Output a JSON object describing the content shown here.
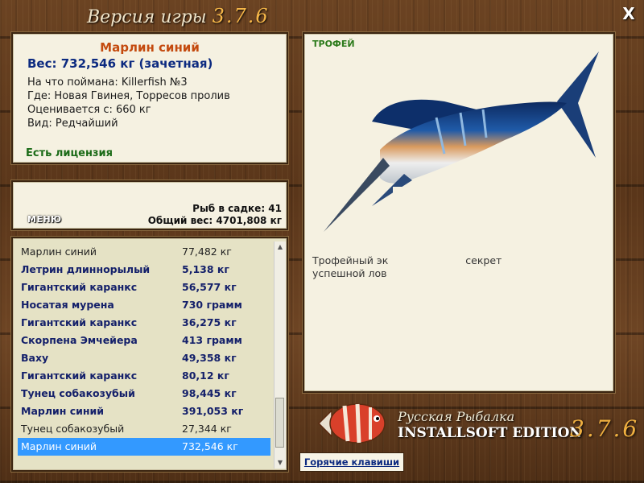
{
  "window": {
    "title": "Версия игры",
    "version": "3.7.6",
    "close_label": "X"
  },
  "info": {
    "fish_name": "Марлин синий",
    "weight": "Вес: 732,546 кг (зачетная)",
    "bait": "На что поймана: Killerfish №3",
    "location": "Где: Новая Гвинея, Торресов пролив",
    "valued_from": "Оценивается с: 660 кг",
    "rarity": "Вид: Редчайший",
    "license": "Есть лицензия"
  },
  "stats": {
    "menu_label": "МЕНЮ",
    "fish_in_cage": "Рыб в садке: 41",
    "total_weight": "Общий вес: 4701,808 кг"
  },
  "catch_list": [
    {
      "name": "Марлин синий",
      "weight": "77,482 кг",
      "style": "plain"
    },
    {
      "name": "Летрин длиннорылый",
      "weight": "5,138 кг",
      "style": "bold"
    },
    {
      "name": "Гигантский каранкс",
      "weight": "56,577 кг",
      "style": "bold"
    },
    {
      "name": "Носатая мурена",
      "weight": "730 грамм",
      "style": "bold"
    },
    {
      "name": "Гигантский каранкс",
      "weight": "36,275 кг",
      "style": "bold"
    },
    {
      "name": "Скорпена Эмчейера",
      "weight": "413 грамм",
      "style": "bold"
    },
    {
      "name": "Ваху",
      "weight": "49,358 кг",
      "style": "bold"
    },
    {
      "name": "Гигантский каранкс",
      "weight": "80,12 кг",
      "style": "bold"
    },
    {
      "name": "Тунец собакозубый",
      "weight": "98,445 кг",
      "style": "bold"
    },
    {
      "name": "Марлин синий",
      "weight": "391,053 кг",
      "style": "bold"
    },
    {
      "name": "Тунец собакозубый",
      "weight": "27,344 кг",
      "style": "plain"
    },
    {
      "name": "Марлин синий",
      "weight": "732,546 кг",
      "style": "sel"
    }
  ],
  "trophy": {
    "label": "ТРОФЕЙ",
    "desc_part1": "Трофейный эк",
    "desc_part2": "секрет",
    "desc_line2": "успешной лов"
  },
  "footer": {
    "brand_line1": "Русская Рыбалка",
    "brand_line2": "INSTALLSOFT EDITION",
    "brand_version": "3.7.6",
    "hotkeys_label": "Горячие клавиши"
  },
  "icons": {
    "close": "close-icon",
    "logo": "red-fish-logo-icon",
    "scroll_up": "scroll-up-icon",
    "scroll_down": "scroll-down-icon"
  }
}
